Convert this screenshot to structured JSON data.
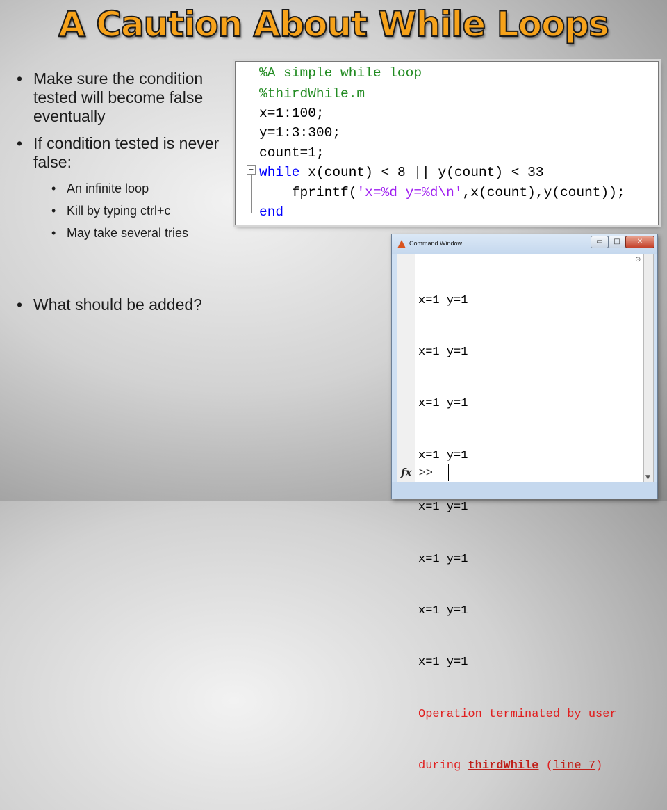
{
  "slide": {
    "title": "A Caution About While Loops",
    "title_color": "#f6a21a"
  },
  "bullets": [
    "Make sure the condition tested will become false eventually",
    "If condition tested is never false:",
    "What should be added?"
  ],
  "sub_bullets": [
    "An infinite loop",
    "Kill by typing ctrl+c",
    "May take several tries"
  ],
  "code": {
    "lines": [
      "%A simple while loop",
      "%thirdWhile.m",
      "x=1:100;",
      "y=1:3:300;",
      "count=1;",
      "while",
      " x(count) < 8 || y(count) < 33",
      "    fprintf(",
      "'x=%d y=%d\\n'",
      ",x(count),y(count));",
      "end"
    ],
    "fold_icon": "minus-box-icon",
    "comment_color": "#228b22",
    "keyword_color": "#0000ff",
    "string_color": "#a020f0"
  },
  "command_window": {
    "title": "Command Window",
    "output_lines": [
      "x=1 y=1",
      "x=1 y=1",
      "x=1 y=1",
      "x=1 y=1",
      "x=1 y=1",
      "x=1 y=1",
      "x=1 y=1",
      "x=1 y=1"
    ],
    "error": {
      "line1": "Operation terminated by user",
      "line2_prefix": "during ",
      "function_link": "thirdWhile",
      "paren_open": " (",
      "line_link": "line 7",
      "paren_close": ")"
    },
    "prompt": ">>",
    "fx_label": "fx",
    "buttons": {
      "minimize": "▭",
      "maximize": "□",
      "close": "✕"
    },
    "error_color": "#e02020"
  }
}
